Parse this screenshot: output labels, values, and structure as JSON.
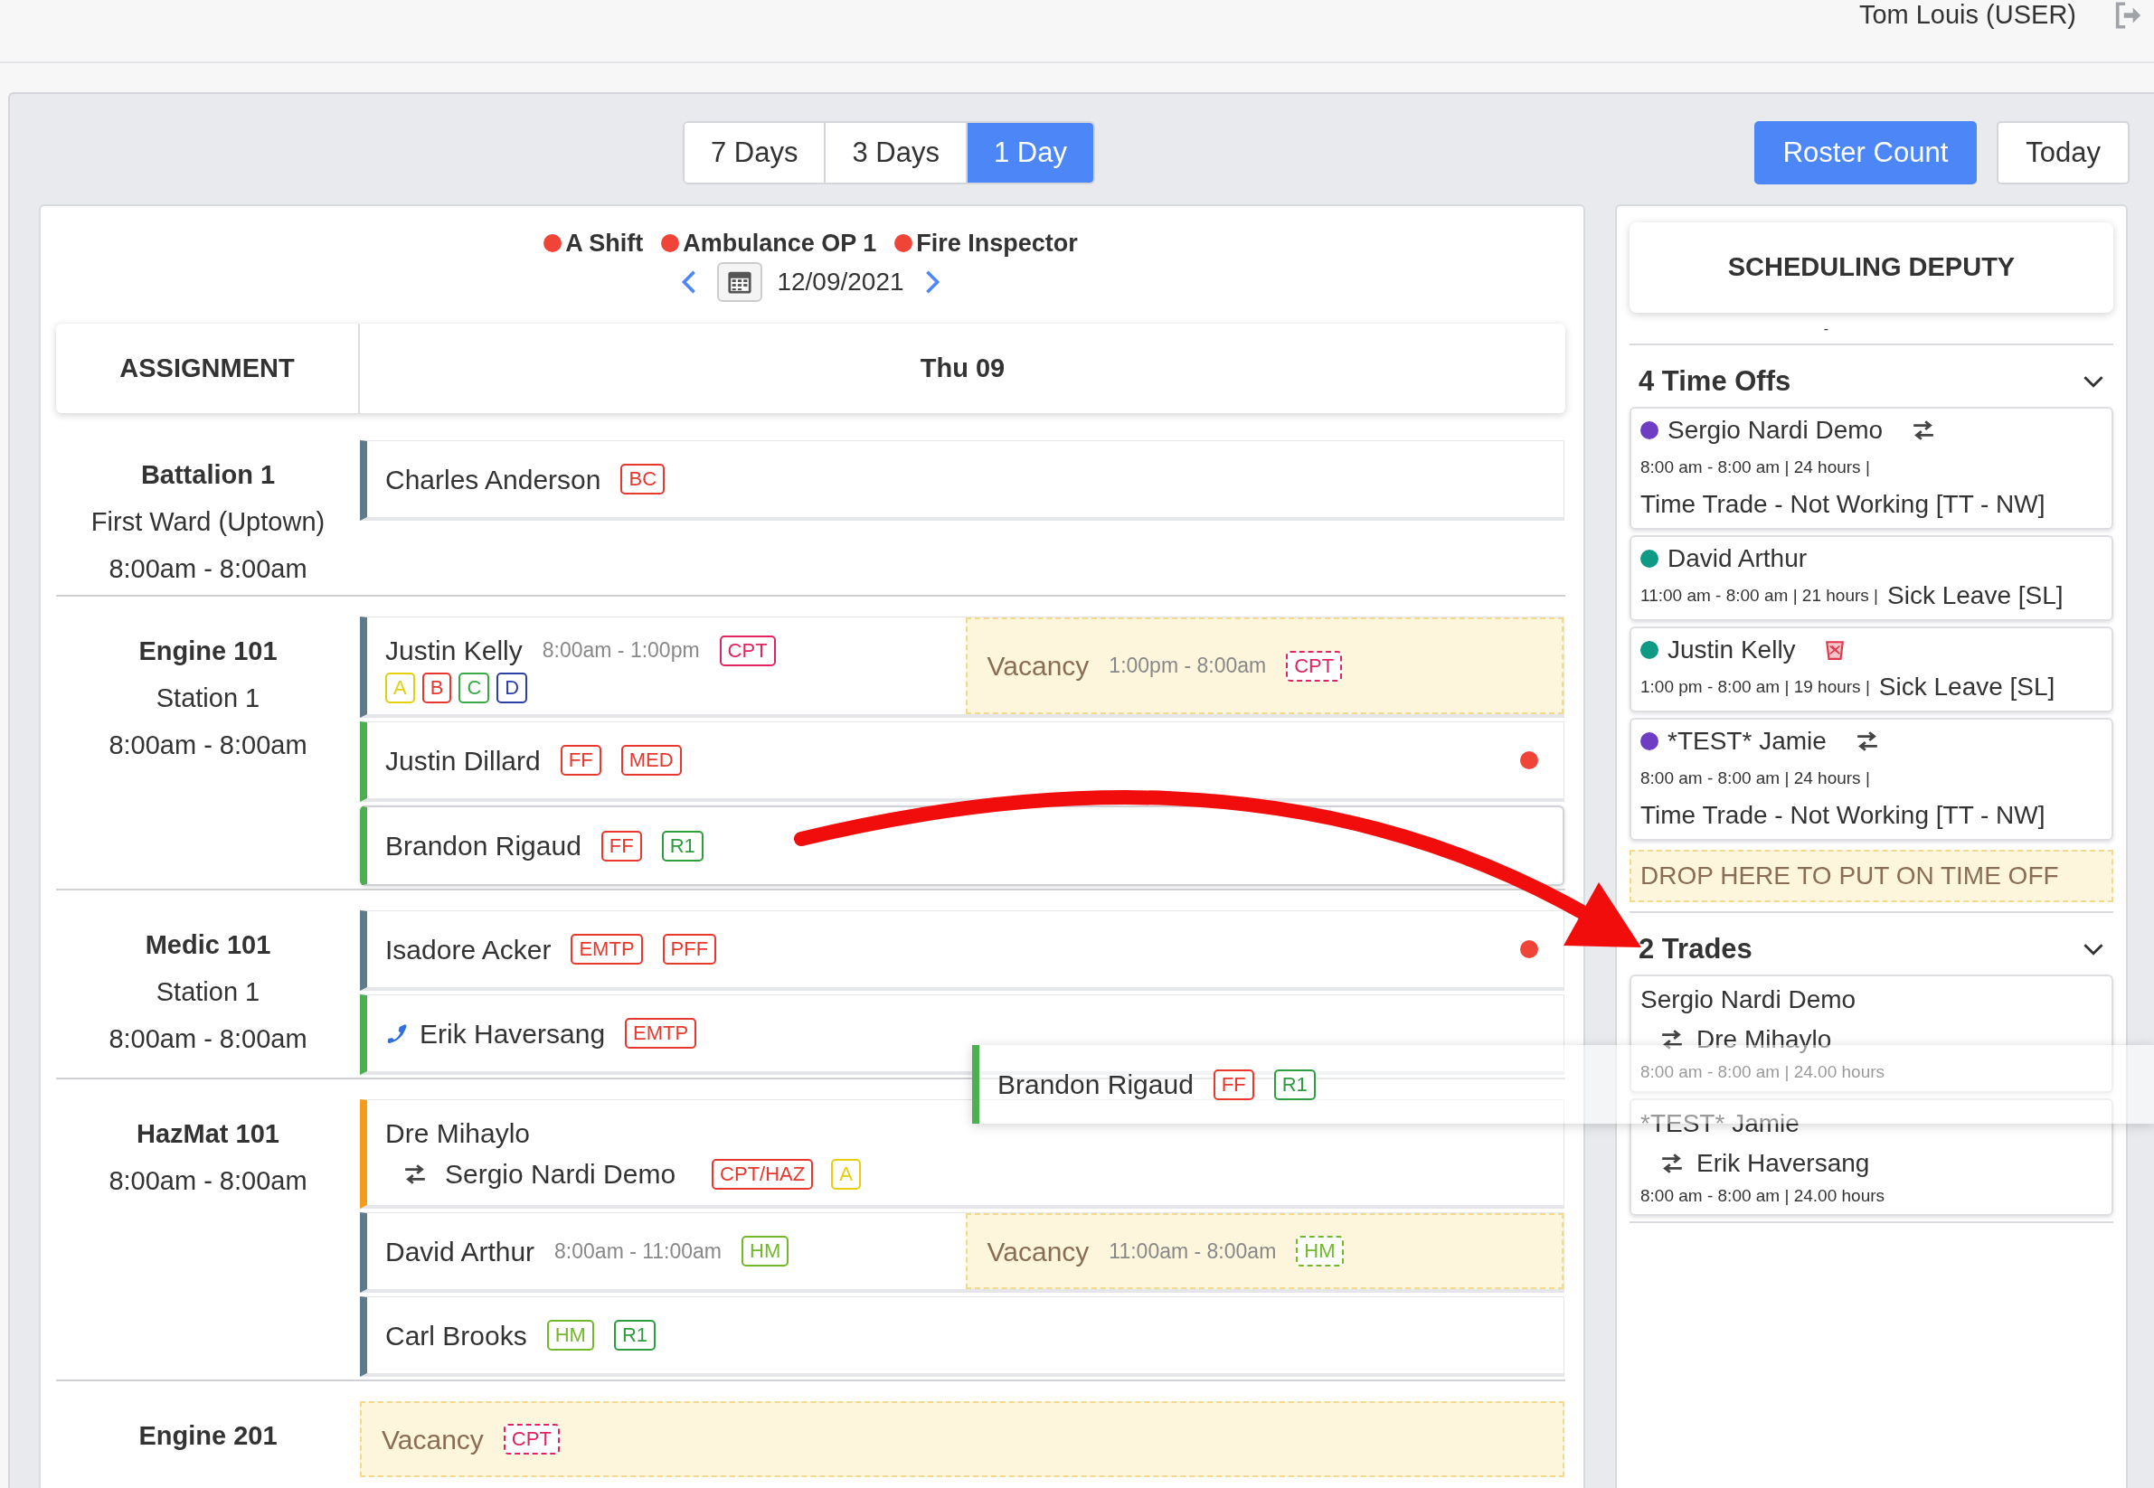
{
  "header": {
    "user": "Tom Louis (USER)"
  },
  "view_toggle": [
    {
      "label": "7 Days",
      "selected": false
    },
    {
      "label": "3 Days",
      "selected": false
    },
    {
      "label": "1 Day",
      "selected": true
    }
  ],
  "actions": [
    {
      "label": "Roster Count",
      "kind": "primary"
    },
    {
      "label": "Today",
      "kind": "outline"
    }
  ],
  "legend": [
    {
      "label": "A Shift",
      "color": "#f04438"
    },
    {
      "label": "Ambulance OP 1",
      "color": "#f04438"
    },
    {
      "label": "Fire Inspector",
      "color": "#f04438"
    }
  ],
  "date": "12/09/2021",
  "schedule": {
    "columns": [
      "ASSIGNMENT",
      "Thu 09"
    ],
    "groups": [
      {
        "title": "Battalion 1",
        "lines": [
          "First Ward (Uptown)",
          "8:00am - 8:00am"
        ],
        "slots": [
          {
            "kind": "person",
            "name": "Charles Anderson",
            "color": "#5e7b8c",
            "tags": [
              {
                "label": "BC",
                "color": "#e8372c"
              }
            ]
          }
        ]
      },
      {
        "title": "Engine 101",
        "lines": [
          "Station 1",
          "8:00am - 8:00am"
        ],
        "slots": [
          {
            "kind": "person",
            "name": "Justin Kelly",
            "color": "#5e7b8c",
            "time": "8:00am - 1:00pm",
            "tags": [
              {
                "label": "CPT",
                "color": "#e0245e"
              }
            ],
            "sub_tags": [
              {
                "label": "A",
                "color": "#e6cf0c"
              },
              {
                "label": "B",
                "color": "#e8372c"
              },
              {
                "label": "C",
                "color": "#3aa845"
              },
              {
                "label": "D",
                "color": "#2b3fa6"
              }
            ],
            "vacancy": {
              "label": "Vacancy",
              "time": "1:00pm - 8:00am",
              "tags": [
                {
                  "label": "CPT",
                  "color": "#e0245e",
                  "dashed": true
                }
              ]
            }
          },
          {
            "kind": "person",
            "name": "Justin Dillard",
            "color": "#4caf50",
            "tags": [
              {
                "label": "FF",
                "color": "#e8372c"
              },
              {
                "label": "MED",
                "color": "#e8372c"
              }
            ],
            "flagged": true
          },
          {
            "kind": "person",
            "name": "Brandon Rigaud",
            "color": "#4caf50",
            "tags": [
              {
                "label": "FF",
                "color": "#e8372c"
              },
              {
                "label": "R1",
                "color": "#2e9d3f"
              }
            ],
            "dragging": true
          }
        ]
      },
      {
        "title": "Medic 101",
        "lines": [
          "Station 1",
          "8:00am - 8:00am"
        ],
        "slots": [
          {
            "kind": "person",
            "name": "Isadore Acker",
            "color": "#5e7b8c",
            "tags": [
              {
                "label": "EMTP",
                "color": "#e8372c"
              },
              {
                "label": "PFF",
                "color": "#e8372c"
              }
            ],
            "flagged": true
          },
          {
            "kind": "phone",
            "name": "Erik Haversang",
            "color": "#4caf50",
            "tags": [
              {
                "label": "EMTP",
                "color": "#e8372c"
              }
            ]
          }
        ]
      },
      {
        "title": "HazMat 101",
        "lines": [
          "8:00am - 8:00am"
        ],
        "slots": [
          {
            "kind": "person",
            "name": "Dre Mihaylo",
            "color": "#f59d1a",
            "trade": {
              "name": "Sergio Nardi Demo",
              "tags": [
                {
                  "label": "CPT/HAZ",
                  "color": "#e8372c"
                },
                {
                  "label": "A",
                  "color": "#e6cf0c"
                }
              ]
            }
          },
          {
            "kind": "person",
            "name": "David Arthur",
            "color": "#5e7b8c",
            "time": "8:00am - 11:00am",
            "tags": [
              {
                "label": "HM",
                "color": "#72b82a"
              }
            ],
            "vacancy": {
              "label": "Vacancy",
              "time": "11:00am - 8:00am",
              "tags": [
                {
                  "label": "HM",
                  "color": "#72b82a",
                  "dashed": true
                }
              ]
            }
          },
          {
            "kind": "person",
            "name": "Carl Brooks",
            "color": "#5e7b8c",
            "tags": [
              {
                "label": "HM",
                "color": "#72b82a"
              },
              {
                "label": "R1",
                "color": "#2e9d3f"
              }
            ]
          }
        ]
      },
      {
        "title": "Engine 201",
        "slots": [
          {
            "kind": "open",
            "vacancy": {
              "label": "Vacancy",
              "tags": [
                {
                  "label": "CPT",
                  "color": "#e0245e",
                  "dashed": true
                }
              ]
            }
          }
        ]
      }
    ]
  },
  "deputy": {
    "title": "SCHEDULING DEPUTY",
    "subtitle": "-",
    "time_offs": {
      "title": "4 Time Offs",
      "expanded": true,
      "items": [
        {
          "kind": "trade",
          "name": "Sergio Nardi Demo",
          "color": "#6f3cc4",
          "time": "8:00 am - 8:00 am | 24 hours |",
          "reason": "Time Trade - Not Working [TT - NW]"
        },
        {
          "kind": "plain",
          "name": "David Arthur",
          "color": "#0f9a86",
          "time": "11:00 am - 8:00 am | 21 hours |",
          "reason": "Sick Leave [SL]"
        },
        {
          "kind": "removable",
          "name": "Justin Kelly",
          "color": "#0f9a86",
          "time": "1:00 pm - 8:00 am | 19 hours |",
          "reason": "Sick Leave [SL]"
        },
        {
          "kind": "trade",
          "name": "*TEST* Jamie",
          "color": "#6f3cc4",
          "time": "8:00 am - 8:00 am | 24 hours |",
          "reason": "Time Trade - Not Working [TT - NW]"
        }
      ]
    },
    "drop_zone": "DROP HERE TO PUT ON TIME OFF",
    "trades": {
      "title": "2 Trades",
      "expanded": true,
      "items": [
        {
          "from": "Sergio Nardi Demo",
          "to": "Dre Mihaylo",
          "time": "8:00 am - 8:00 am | 24.00 hours"
        },
        {
          "from": "*TEST* Jamie",
          "to": "Erik Haversang",
          "time": "8:00 am - 8:00 am | 24.00 hours"
        }
      ]
    }
  },
  "drag_preview": {
    "name": "Brandon Rigaud",
    "color": "#4caf50",
    "tags": [
      {
        "label": "FF",
        "color": "#e8372c"
      },
      {
        "label": "R1",
        "color": "#2e9d3f"
      }
    ]
  }
}
